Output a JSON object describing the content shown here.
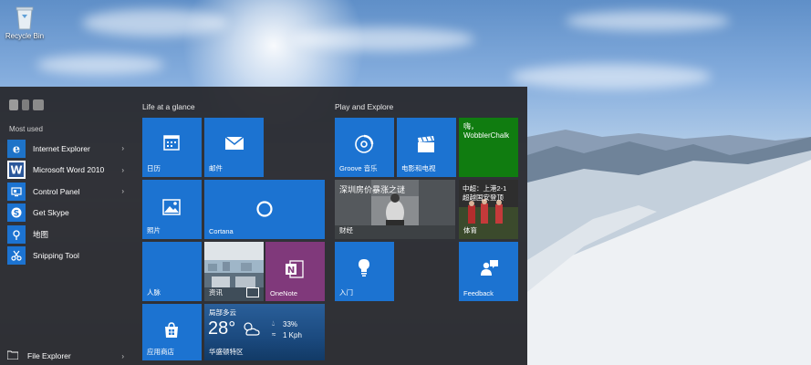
{
  "desktop": {
    "recycle_bin_label": "Recycle Bin"
  },
  "start_menu": {
    "most_used_label": "Most used",
    "apps": [
      {
        "label": "Internet Explorer",
        "icon": "internet-explorer-icon",
        "has_submenu": true
      },
      {
        "label": "Microsoft Word 2010",
        "icon": "word-icon",
        "has_submenu": true
      },
      {
        "label": "Control Panel",
        "icon": "control-panel-icon",
        "has_submenu": true
      },
      {
        "label": "Get Skype",
        "icon": "skype-icon",
        "has_submenu": false
      },
      {
        "label": "地图",
        "icon": "maps-icon",
        "has_submenu": false
      },
      {
        "label": "Snipping Tool",
        "icon": "scissors-icon",
        "has_submenu": false
      }
    ],
    "file_explorer_label": "File Explorer",
    "groups": {
      "life": "Life at a glance",
      "play": "Play and Explore"
    },
    "tiles": {
      "calendar": "日历",
      "mail": "邮件",
      "photos": "照片",
      "cortana": "Cortana",
      "people": "人脉",
      "news": "资讯",
      "onenote": "OneNote",
      "store": "应用商店",
      "weather": {
        "condition": "局部多云",
        "temperature": "28°",
        "humidity": "33%",
        "wind": "1 Kph",
        "city": "华盛顿特区"
      },
      "groove": "Groove 音乐",
      "movies": "电影和电视",
      "wobbler": {
        "line1": "嗨，",
        "line2": "WobblerChalk"
      },
      "finance": {
        "headline": "深圳房价暴涨之谜",
        "label": "财经"
      },
      "sports": {
        "headline_line1": "中超：上港2-1",
        "headline_line2": "超越国安登顶",
        "label": "体育"
      },
      "getstarted": "入门",
      "feedback": "Feedback"
    }
  },
  "colors": {
    "tile_blue": "#1c73d1",
    "onenote_purple": "#80397b",
    "xbox_green": "#107c10",
    "start_bg": "#26262a"
  }
}
